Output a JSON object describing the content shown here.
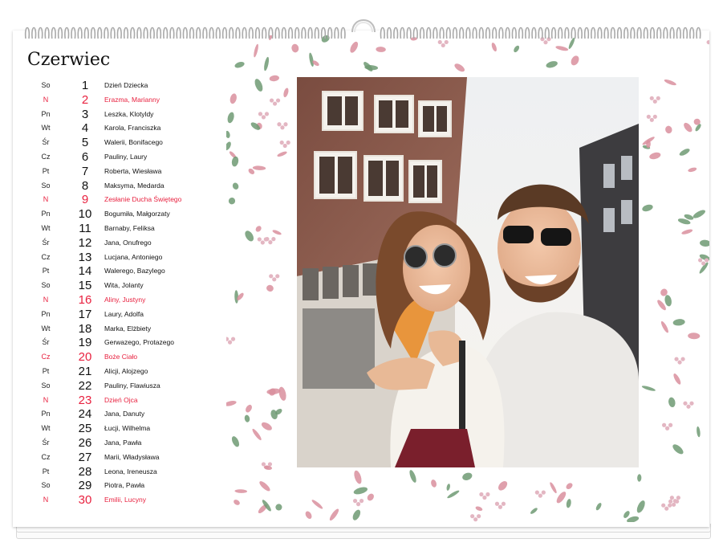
{
  "calendar": {
    "month": "Czerwiec",
    "days": [
      {
        "wd": "So",
        "num": "1",
        "names": "Dzień Dziecka",
        "holiday": false
      },
      {
        "wd": "N",
        "num": "2",
        "names": "Erazma, Marianny",
        "holiday": true
      },
      {
        "wd": "Pn",
        "num": "3",
        "names": "Leszka, Klotyldy",
        "holiday": false
      },
      {
        "wd": "Wt",
        "num": "4",
        "names": "Karola, Franciszka",
        "holiday": false
      },
      {
        "wd": "Śr",
        "num": "5",
        "names": "Walerii, Bonifacego",
        "holiday": false
      },
      {
        "wd": "Cz",
        "num": "6",
        "names": "Pauliny, Laury",
        "holiday": false
      },
      {
        "wd": "Pt",
        "num": "7",
        "names": "Roberta, Wiesława",
        "holiday": false
      },
      {
        "wd": "So",
        "num": "8",
        "names": "Maksyma, Medarda",
        "holiday": false
      },
      {
        "wd": "N",
        "num": "9",
        "names": "Zesłanie Ducha Świętego",
        "holiday": true
      },
      {
        "wd": "Pn",
        "num": "10",
        "names": "Bogumiła, Małgorzaty",
        "holiday": false
      },
      {
        "wd": "Wt",
        "num": "11",
        "names": "Barnaby, Feliksa",
        "holiday": false
      },
      {
        "wd": "Śr",
        "num": "12",
        "names": "Jana, Onufrego",
        "holiday": false
      },
      {
        "wd": "Cz",
        "num": "13",
        "names": "Lucjana, Antoniego",
        "holiday": false
      },
      {
        "wd": "Pt",
        "num": "14",
        "names": "Walerego, Bazylego",
        "holiday": false
      },
      {
        "wd": "So",
        "num": "15",
        "names": "Wita, Jolanty",
        "holiday": false
      },
      {
        "wd": "N",
        "num": "16",
        "names": "Aliny, Justyny",
        "holiday": true
      },
      {
        "wd": "Pn",
        "num": "17",
        "names": "Laury, Adolfa",
        "holiday": false
      },
      {
        "wd": "Wt",
        "num": "18",
        "names": "Marka, Elżbiety",
        "holiday": false
      },
      {
        "wd": "Śr",
        "num": "19",
        "names": "Gerwazego, Protazego",
        "holiday": false
      },
      {
        "wd": "Cz",
        "num": "20",
        "names": "Boże Ciało",
        "holiday": true
      },
      {
        "wd": "Pt",
        "num": "21",
        "names": "Alicji, Alojzego",
        "holiday": false
      },
      {
        "wd": "So",
        "num": "22",
        "names": "Pauliny, Flawiusza",
        "holiday": false
      },
      {
        "wd": "N",
        "num": "23",
        "names": "Dzień Ojca",
        "holiday": true
      },
      {
        "wd": "Pn",
        "num": "24",
        "names": "Jana, Danuty",
        "holiday": false
      },
      {
        "wd": "Wt",
        "num": "25",
        "names": "Łucji, Wilhelma",
        "holiday": false
      },
      {
        "wd": "Śr",
        "num": "26",
        "names": "Jana, Pawła",
        "holiday": false
      },
      {
        "wd": "Cz",
        "num": "27",
        "names": "Marii, Władysława",
        "holiday": false
      },
      {
        "wd": "Pt",
        "num": "28",
        "names": "Leona, Ireneusza",
        "holiday": false
      },
      {
        "wd": "So",
        "num": "29",
        "names": "Piotra, Pawła",
        "holiday": false
      },
      {
        "wd": "N",
        "num": "30",
        "names": "Emilii, Lucyny",
        "holiday": true
      }
    ]
  },
  "colors": {
    "holiday_red": "#e8213f",
    "text": "#111111",
    "leaf_pink": "#d98f9e",
    "leaf_green": "#6f9a73",
    "brick": "#8b5a4b"
  },
  "icons": {
    "binding": "spiral-binding",
    "hanger": "hanger-hook",
    "border": "floral-leaf-pattern"
  }
}
